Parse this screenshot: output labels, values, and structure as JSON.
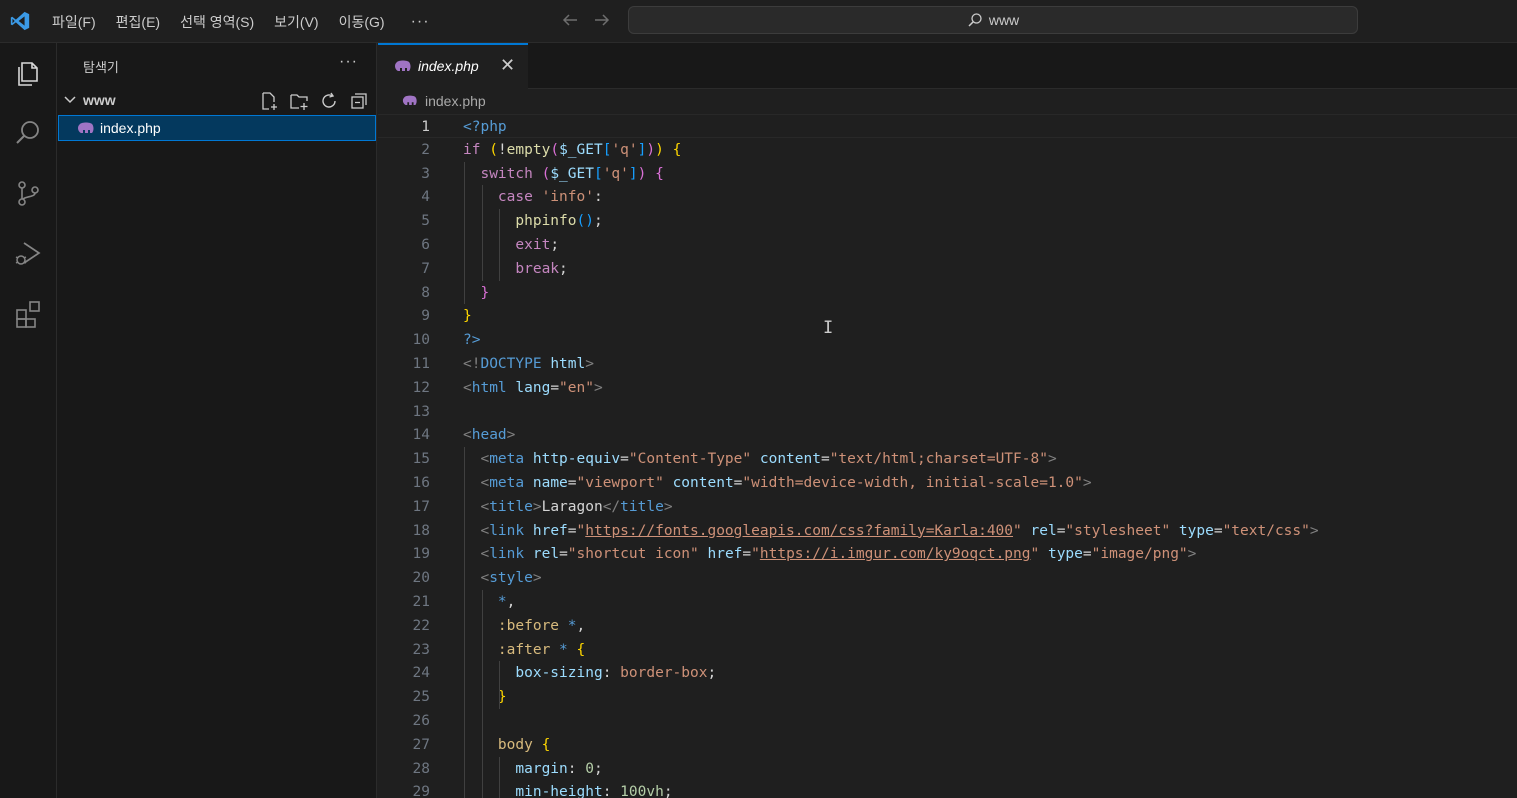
{
  "titlebar": {
    "menus": [
      "파일(F)",
      "편집(E)",
      "선택 영역(S)",
      "보기(V)",
      "이동(G)"
    ],
    "more": "···",
    "search_text": "www"
  },
  "sidebar": {
    "title": "탐색기",
    "more": "···",
    "folder": "www",
    "file": "index.php"
  },
  "tab": {
    "label": "index.php",
    "close": "✕"
  },
  "breadcrumb": {
    "file": "index.php"
  },
  "colors": {
    "keyword": "#c586c0",
    "control": "#c586c0",
    "string": "#ce9178",
    "tag": "#569cd6",
    "attr": "#9cdcfe",
    "func": "#dcdcaa",
    "variable": "#9cdcfe",
    "bracket1": "#ffd700",
    "bracket2": "#da70d6",
    "bracket3": "#179fff",
    "plain": "#d4d4d4",
    "number": "#b5cea8",
    "punct": "#808080",
    "css_sel": "#d7ba7d",
    "accent": "#0078d4"
  },
  "code": [
    {
      "n": "1",
      "t": [
        [
          "<?php",
          "tag"
        ]
      ]
    },
    {
      "n": "2",
      "t": [
        [
          "if ",
          "control"
        ],
        [
          "(",
          "bracket1"
        ],
        [
          "!",
          "plain"
        ],
        [
          "empty",
          "func"
        ],
        [
          "(",
          "bracket2"
        ],
        [
          "$_GET",
          "variable"
        ],
        [
          "[",
          "bracket3"
        ],
        [
          "'q'",
          "string"
        ],
        [
          "]",
          "bracket3"
        ],
        [
          ")",
          "bracket2"
        ],
        [
          ")",
          "bracket1"
        ],
        [
          " ",
          "plain"
        ],
        [
          "{",
          "bracket1"
        ]
      ]
    },
    {
      "n": "3",
      "t": [
        [
          "  switch ",
          "control"
        ],
        [
          "(",
          "bracket2"
        ],
        [
          "$_GET",
          "variable"
        ],
        [
          "[",
          "bracket3"
        ],
        [
          "'q'",
          "string"
        ],
        [
          "]",
          "bracket3"
        ],
        [
          ")",
          "bracket2"
        ],
        [
          " ",
          "plain"
        ],
        [
          "{",
          "bracket2"
        ]
      ]
    },
    {
      "n": "4",
      "t": [
        [
          "    case ",
          "control"
        ],
        [
          "'info'",
          "string"
        ],
        [
          ":",
          "plain"
        ]
      ]
    },
    {
      "n": "5",
      "t": [
        [
          "      ",
          "plain"
        ],
        [
          "phpinfo",
          "func"
        ],
        [
          "(",
          "bracket3"
        ],
        [
          ")",
          "bracket3"
        ],
        [
          ";",
          "plain"
        ]
      ]
    },
    {
      "n": "6",
      "t": [
        [
          "      exit",
          "control"
        ],
        [
          ";",
          "plain"
        ]
      ]
    },
    {
      "n": "7",
      "t": [
        [
          "      break",
          "control"
        ],
        [
          ";",
          "plain"
        ]
      ]
    },
    {
      "n": "8",
      "t": [
        [
          "  ",
          "plain"
        ],
        [
          "}",
          "bracket2"
        ]
      ]
    },
    {
      "n": "9",
      "t": [
        [
          "}",
          "bracket1"
        ]
      ]
    },
    {
      "n": "10",
      "t": [
        [
          "?>",
          "tag"
        ]
      ]
    },
    {
      "n": "11",
      "t": [
        [
          "<!",
          "punct"
        ],
        [
          "DOCTYPE ",
          "tag"
        ],
        [
          "html",
          "attr"
        ],
        [
          ">",
          "punct"
        ]
      ]
    },
    {
      "n": "12",
      "t": [
        [
          "<",
          "punct"
        ],
        [
          "html ",
          "tag"
        ],
        [
          "lang",
          "attr"
        ],
        [
          "=",
          "plain"
        ],
        [
          "\"en\"",
          "string"
        ],
        [
          ">",
          "punct"
        ]
      ]
    },
    {
      "n": "13",
      "t": []
    },
    {
      "n": "14",
      "t": [
        [
          "<",
          "punct"
        ],
        [
          "head",
          "tag"
        ],
        [
          ">",
          "punct"
        ]
      ]
    },
    {
      "n": "15",
      "t": [
        [
          "  <",
          "punct"
        ],
        [
          "meta ",
          "tag"
        ],
        [
          "http-equiv",
          "attr"
        ],
        [
          "=",
          "plain"
        ],
        [
          "\"Content-Type\"",
          "string"
        ],
        [
          " ",
          "plain"
        ],
        [
          "content",
          "attr"
        ],
        [
          "=",
          "plain"
        ],
        [
          "\"text/html;charset=UTF-8\"",
          "string"
        ],
        [
          ">",
          "punct"
        ]
      ]
    },
    {
      "n": "16",
      "t": [
        [
          "  <",
          "punct"
        ],
        [
          "meta ",
          "tag"
        ],
        [
          "name",
          "attr"
        ],
        [
          "=",
          "plain"
        ],
        [
          "\"viewport\"",
          "string"
        ],
        [
          " ",
          "plain"
        ],
        [
          "content",
          "attr"
        ],
        [
          "=",
          "plain"
        ],
        [
          "\"width=device-width, initial-scale=1.0\"",
          "string"
        ],
        [
          ">",
          "punct"
        ]
      ]
    },
    {
      "n": "17",
      "t": [
        [
          "  <",
          "punct"
        ],
        [
          "title",
          "tag"
        ],
        [
          ">",
          "punct"
        ],
        [
          "Laragon",
          "plain"
        ],
        [
          "</",
          "punct"
        ],
        [
          "title",
          "tag"
        ],
        [
          ">",
          "punct"
        ]
      ]
    },
    {
      "n": "18",
      "t": [
        [
          "  <",
          "punct"
        ],
        [
          "link ",
          "tag"
        ],
        [
          "href",
          "attr"
        ],
        [
          "=",
          "plain"
        ],
        [
          "\"",
          "string"
        ],
        [
          "https://fonts.googleapis.com/css?family=Karla:400",
          "link"
        ],
        [
          "\"",
          "string"
        ],
        [
          " ",
          "plain"
        ],
        [
          "rel",
          "attr"
        ],
        [
          "=",
          "plain"
        ],
        [
          "\"stylesheet\"",
          "string"
        ],
        [
          " ",
          "plain"
        ],
        [
          "type",
          "attr"
        ],
        [
          "=",
          "plain"
        ],
        [
          "\"text/css\"",
          "string"
        ],
        [
          ">",
          "punct"
        ]
      ]
    },
    {
      "n": "19",
      "t": [
        [
          "  <",
          "punct"
        ],
        [
          "link ",
          "tag"
        ],
        [
          "rel",
          "attr"
        ],
        [
          "=",
          "plain"
        ],
        [
          "\"shortcut icon\"",
          "string"
        ],
        [
          " ",
          "plain"
        ],
        [
          "href",
          "attr"
        ],
        [
          "=",
          "plain"
        ],
        [
          "\"",
          "string"
        ],
        [
          "https://i.imgur.com/ky9oqct.png",
          "link"
        ],
        [
          "\"",
          "string"
        ],
        [
          " ",
          "plain"
        ],
        [
          "type",
          "attr"
        ],
        [
          "=",
          "plain"
        ],
        [
          "\"image/png\"",
          "string"
        ],
        [
          ">",
          "punct"
        ]
      ]
    },
    {
      "n": "20",
      "t": [
        [
          "  <",
          "punct"
        ],
        [
          "style",
          "tag"
        ],
        [
          ">",
          "punct"
        ]
      ]
    },
    {
      "n": "21",
      "t": [
        [
          "    *",
          "tag"
        ],
        [
          ",",
          "plain"
        ]
      ]
    },
    {
      "n": "22",
      "t": [
        [
          "    :before ",
          "css_sel"
        ],
        [
          "*",
          "tag"
        ],
        [
          ",",
          "plain"
        ]
      ]
    },
    {
      "n": "23",
      "t": [
        [
          "    :after ",
          "css_sel"
        ],
        [
          "*",
          "tag"
        ],
        [
          " ",
          "plain"
        ],
        [
          "{",
          "bracket1"
        ]
      ]
    },
    {
      "n": "24",
      "t": [
        [
          "      ",
          "plain"
        ],
        [
          "box-sizing",
          "attr"
        ],
        [
          ": ",
          "plain"
        ],
        [
          "border-box",
          "string"
        ],
        [
          ";",
          "plain"
        ]
      ]
    },
    {
      "n": "25",
      "t": [
        [
          "    ",
          "plain"
        ],
        [
          "}",
          "bracket1"
        ]
      ]
    },
    {
      "n": "26",
      "t": []
    },
    {
      "n": "27",
      "t": [
        [
          "    body ",
          "css_sel"
        ],
        [
          "{",
          "bracket1"
        ]
      ]
    },
    {
      "n": "28",
      "t": [
        [
          "      ",
          "plain"
        ],
        [
          "margin",
          "attr"
        ],
        [
          ": ",
          "plain"
        ],
        [
          "0",
          "number"
        ],
        [
          ";",
          "plain"
        ]
      ]
    },
    {
      "n": "29",
      "t": [
        [
          "      ",
          "plain"
        ],
        [
          "min-height",
          "attr"
        ],
        [
          ": ",
          "plain"
        ],
        [
          "100vh",
          "number"
        ],
        [
          ";",
          "plain"
        ]
      ]
    }
  ]
}
